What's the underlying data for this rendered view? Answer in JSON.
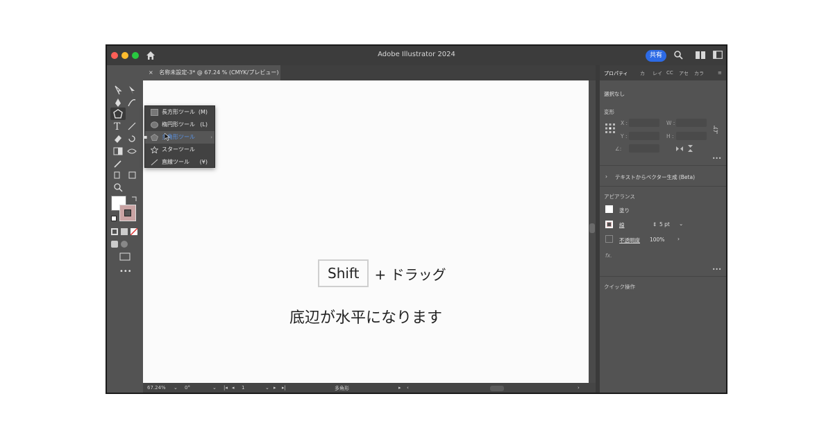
{
  "window": {
    "title": "Adobe Illustrator 2024",
    "share_label": "共有"
  },
  "document": {
    "tab_label": "名称未設定-3* @ 67.24 % (CMYK/プレビュー)",
    "tab_close": "×"
  },
  "flyout": {
    "items": [
      {
        "label": "長方形ツール",
        "key": "(M)",
        "icon": "rectangle-icon"
      },
      {
        "label": "楕円形ツール",
        "key": "(L)",
        "icon": "ellipse-icon"
      },
      {
        "label": "多角形ツール",
        "key": "",
        "icon": "polygon-icon",
        "selected": true
      },
      {
        "label": "スターツール",
        "key": "",
        "icon": "star-icon"
      },
      {
        "label": "直線ツール",
        "key": "(¥)",
        "icon": "line-icon"
      }
    ]
  },
  "canvas": {
    "key_label": "Shift",
    "plus_drag": "+ ドラッグ",
    "result": "底辺が水平になります"
  },
  "statusbar": {
    "zoom": "67.24%",
    "rotation": "0°",
    "artboard": "1",
    "tool": "多角形"
  },
  "panel": {
    "tabs": [
      "プロパティ",
      "カ",
      "レイ",
      "CC",
      "アセ",
      "カラ"
    ],
    "selection": "選択なし",
    "transform": {
      "heading": "変形",
      "x_label": "X :",
      "y_label": "Y :",
      "w_label": "W :",
      "h_label": "H :",
      "angle_label": "∠:"
    },
    "text_to_vector": "テキストからベクター生成 (Beta)",
    "appearance": {
      "heading": "アピアランス",
      "fill": "塗り",
      "stroke": "線",
      "stroke_value": "5 pt",
      "opacity": "不透明度",
      "opacity_value": "100%",
      "fx": "fx."
    },
    "quick_actions": "クイック操作"
  },
  "colors": {
    "accent": "#2d6be6",
    "stroke_swatch": "#c9a3a3",
    "canvas": "#fbfbfb"
  }
}
